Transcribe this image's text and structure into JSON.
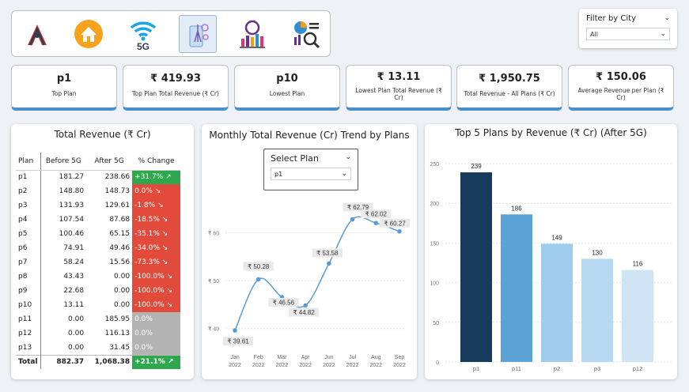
{
  "nav": {
    "items": [
      {
        "name": "brand-logo-icon"
      },
      {
        "name": "home-icon"
      },
      {
        "name": "wifi-5g-icon",
        "label": "5G"
      },
      {
        "name": "tower-icon"
      },
      {
        "name": "analytics-icon"
      },
      {
        "name": "report-search-icon"
      }
    ]
  },
  "filter": {
    "title": "Filter by City",
    "value": "All"
  },
  "kpis": [
    {
      "value": "p1",
      "label": "Top Plan"
    },
    {
      "value": "₹ 419.93",
      "label": "Top Plan Total Revenue (₹ Cr)"
    },
    {
      "value": "p10",
      "label": "Lowest Plan"
    },
    {
      "value": "₹ 13.11",
      "label": "Lowest Plan Total Revenue (₹ Cr)"
    },
    {
      "value": "₹ 1,950.75",
      "label": "Total Revenue - All Plans (₹ Cr)"
    },
    {
      "value": "₹ 150.06",
      "label": "Average Revenue per Plan (₹ Cr)"
    }
  ],
  "table": {
    "title": "Total Revenue (₹ Cr)",
    "headers": [
      "Plan",
      "Before 5G",
      "After 5G",
      "% Change"
    ],
    "rows": [
      {
        "plan": "p1",
        "before": "181.27",
        "after": "238.66",
        "change": "+31.7% ↗",
        "color": "#2ea84d"
      },
      {
        "plan": "p2",
        "before": "148.80",
        "after": "148.73",
        "change": "0.0% ↘",
        "color": "#e24a3b"
      },
      {
        "plan": "p3",
        "before": "131.93",
        "after": "129.61",
        "change": "-1.8% ↘",
        "color": "#e24a3b"
      },
      {
        "plan": "p4",
        "before": "107.54",
        "after": "87.68",
        "change": "-18.5% ↘",
        "color": "#e24a3b"
      },
      {
        "plan": "p5",
        "before": "100.46",
        "after": "65.15",
        "change": "-35.1% ↘",
        "color": "#e24a3b"
      },
      {
        "plan": "p6",
        "before": "74.91",
        "after": "49.46",
        "change": "-34.0% ↘",
        "color": "#e24a3b"
      },
      {
        "plan": "p7",
        "before": "58.24",
        "after": "15.56",
        "change": "-73.3% ↘",
        "color": "#e24a3b"
      },
      {
        "plan": "p8",
        "before": "43.43",
        "after": "0.00",
        "change": "-100.0% ↘",
        "color": "#e24a3b"
      },
      {
        "plan": "p9",
        "before": "22.68",
        "after": "0.00",
        "change": "-100.0% ↘",
        "color": "#e24a3b"
      },
      {
        "plan": "p10",
        "before": "13.11",
        "after": "0.00",
        "change": "-100.0% ↘",
        "color": "#e24a3b"
      },
      {
        "plan": "p11",
        "before": "0.00",
        "after": "185.95",
        "change": "0.0%",
        "color": "#b3b3b3"
      },
      {
        "plan": "p12",
        "before": "0.00",
        "after": "116.13",
        "change": "0.0%",
        "color": "#b3b3b3"
      },
      {
        "plan": "p13",
        "before": "0.00",
        "after": "31.45",
        "change": "0.0%",
        "color": "#b3b3b3"
      }
    ],
    "total": {
      "plan": "Total",
      "before": "882.37",
      "after": "1,068.38",
      "change": "+21.1% ↗",
      "color": "#2ea84d"
    }
  },
  "trend": {
    "title": "Monthly Total Revenue (Cr) Trend by Plans",
    "select_title": "Select Plan",
    "select_value": "p1"
  },
  "top5": {
    "title": "Top 5 Plans by Revenue (₹ Cr) (After 5G)"
  },
  "chart_data": [
    {
      "type": "line",
      "title": "Monthly Total Revenue (Cr) Trend by Plans",
      "x": [
        "Jan 2022",
        "Feb 2022",
        "Mar 2022",
        "Apr 2022",
        "Jun 2022",
        "Jul 2022",
        "Aug 2022",
        "Sep 2022"
      ],
      "series": [
        {
          "values": [
            39.61,
            50.28,
            46.56,
            44.82,
            53.58,
            62.79,
            62.02,
            60.27
          ]
        }
      ],
      "data_labels": [
        "₹ 39.61",
        "₹ 50.28",
        "₹ 46.56",
        "₹ 44.82",
        "₹ 53.58",
        "₹ 62.79",
        "₹ 62.02",
        "₹ 60.27"
      ],
      "y_ticks": [
        40,
        50,
        60
      ],
      "y_tick_labels": [
        "₹ 40",
        "₹ 50",
        "₹ 60"
      ],
      "ylim": [
        36,
        67
      ],
      "color": "#5b9bd5"
    },
    {
      "type": "bar",
      "title": "Top 5 Plans by Revenue (₹ Cr) (After 5G)",
      "categories": [
        "p1",
        "p11",
        "p2",
        "p3",
        "p12"
      ],
      "values": [
        239,
        186,
        149,
        130,
        116
      ],
      "colors": [
        "#163b5c",
        "#5aa3d4",
        "#9fcbec",
        "#b7d9f2",
        "#cfe5f6"
      ],
      "y_ticks": [
        0,
        50,
        100,
        150,
        200,
        250
      ],
      "ylim": [
        0,
        257
      ],
      "grid": true
    }
  ]
}
